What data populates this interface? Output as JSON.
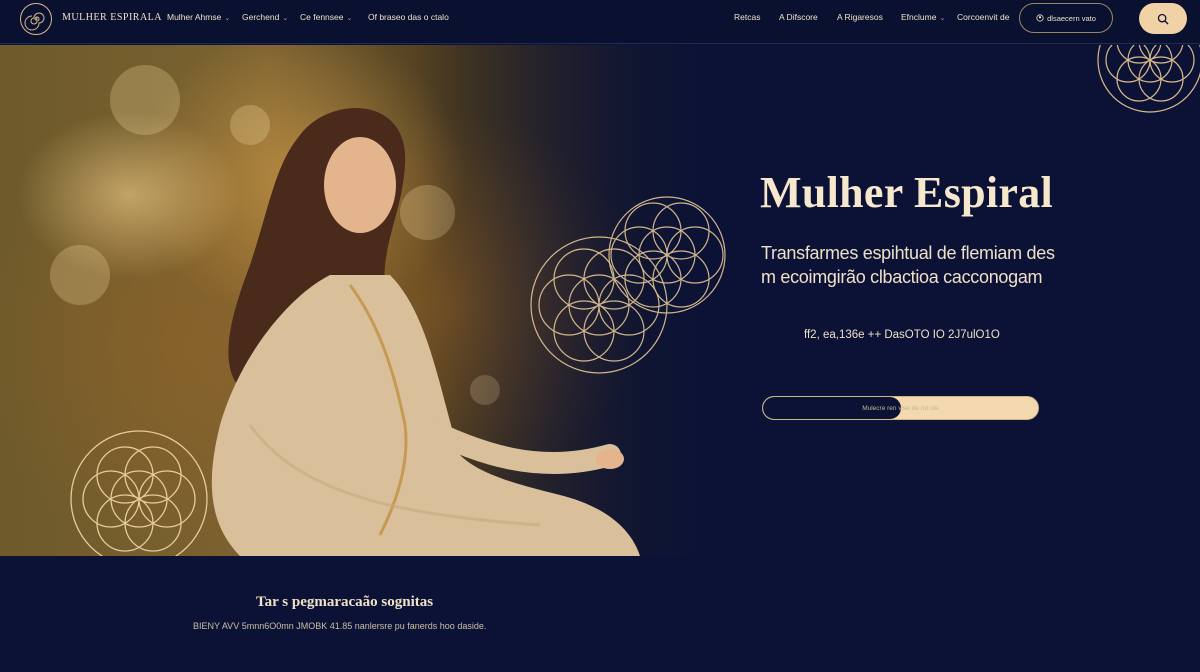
{
  "header": {
    "brand": "MULHER ESPIRALA",
    "nav_left": [
      {
        "label": "Mulher Ahmse",
        "dropdown": true
      },
      {
        "label": "Gerchend",
        "dropdown": true
      },
      {
        "label": "Ce fennsee",
        "dropdown": true
      },
      {
        "label": "Of braseo das o ctalo",
        "dropdown": false
      }
    ],
    "nav_right": [
      {
        "label": "Retcas",
        "dropdown": false
      },
      {
        "label": "A Difscore",
        "dropdown": false
      },
      {
        "label": "A Rigaresos",
        "dropdown": false
      },
      {
        "label": "Efnclume",
        "dropdown": true
      },
      {
        "label": "Corcoenvit de",
        "dropdown": false
      }
    ],
    "account_label": "dlsaecern vato"
  },
  "hero": {
    "title": "Mulher Espiral",
    "subtitle": "Transfarmes espihtual de flemiam des m ecoimgirão clbactioa cacconogam",
    "date_text": "ff2, ea,136e ++ DasOTO IO 2J7ulO1O",
    "progress_label": "Mulecre ren vise de rot ole",
    "progress_value": 0.5
  },
  "footer": {
    "title": "Tar s pegmaracaão sognitas",
    "text": "BIENY  AVV 5mnn6O0mn  JMOBK  41.85   nanlersre pu fanerds hoo daside."
  },
  "colors": {
    "background": "#0b1236",
    "gold": "#d8b98a",
    "cream": "#f0d2a6"
  },
  "icons": [
    "spiral-logo-icon",
    "chevron-down-icon",
    "user-icon",
    "search-icon",
    "flower-of-life-icon"
  ]
}
